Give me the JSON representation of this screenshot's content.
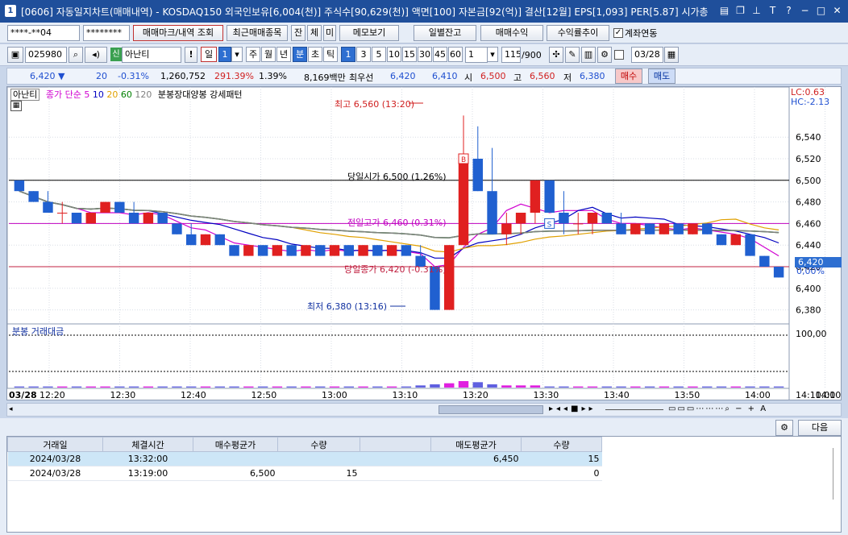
{
  "window": {
    "number": "1",
    "title": "[0606] 자동일지차트(매매내역) - KOSDAQ150 외국인보유[6,004(천)] 주식수[90,629(천)] 액면[100] 자본금[92(억)] 결산[12월] EPS[1,093] PER[5.87] 시가총"
  },
  "toolbar1": {
    "account": "****-**04",
    "password": "********",
    "btn_marks": "매매마크/내역 조회",
    "btn_recent": "최근매매종목",
    "btn_jan": "잔",
    "btn_che": "체",
    "btn_mi": "미",
    "btn_memo": "메모보기",
    "btn_daily": "일별잔고",
    "btn_profit": "매매수익",
    "btn_rate": "수익률추이",
    "chk_link": "계좌연동"
  },
  "toolbar2": {
    "code": "025980",
    "badge": "신",
    "name": "아난티",
    "excl": "!",
    "period_day": "일",
    "period_sel": "1",
    "p_week": "주",
    "p_month": "월",
    "p_year": "년",
    "p_min": "분",
    "p_sec": "초",
    "p_tick": "틱",
    "mins": [
      "1",
      "3",
      "5",
      "10",
      "15",
      "30",
      "45",
      "60"
    ],
    "count": "1",
    "bars": "115",
    "bars_max": "/900",
    "date": "03/28"
  },
  "strip": {
    "price": "6,420 ▼",
    "change": "20",
    "change_pct": "-0.31%",
    "volume": "1,260,752",
    "vol_ratio": "291.39%",
    "turnover": "1.39%",
    "amount": "8,169백만",
    "pref_label": "최우선",
    "ask": "6,420",
    "bid": "6,410",
    "open_label": "시",
    "open": "6,500",
    "high_label": "고",
    "high": "6,560",
    "low_label": "저",
    "low": "6,380",
    "buy": "매수",
    "sell": "매도"
  },
  "chart": {
    "stock_tag": "아난티",
    "legend_label": "종가 단순",
    "ma": [
      "5",
      "10",
      "20",
      "60",
      "120"
    ],
    "ma_colors": [
      "#d000d0",
      "#0000c0",
      "#e0a000",
      "#008000",
      "#808080"
    ],
    "pattern": "분봉장대양봉 강세패턴",
    "lc": "LC:0.63",
    "hc": "HC:-2.13",
    "ann_high": "최고 6,560 (13:20)",
    "ann_low": "최저 6,380 (13:16)",
    "ann_open": "당일시가 6,500 (1.26%)",
    "ann_prev": "전일고가 6,460 (0.31%)",
    "ann_close": "당일종가 6,420 (-0.31%)",
    "cur_price": "6,420",
    "cur_pct": "0,00%",
    "buy_mark": "B",
    "sell_mark": "S",
    "vol_title": "분봉 거래대금",
    "vol_tick": "100,00",
    "date_label": "03/28",
    "time_end": "14:10:00",
    "buy_color": "#e02020",
    "sell_color": "#2060d0"
  },
  "chart_data": {
    "type": "candlestick",
    "y_ticks": [
      "6,540",
      "6,520",
      "6,500",
      "6,480",
      "6,460",
      "6,440",
      "6,420",
      "6,400",
      "6,380"
    ],
    "ylim": [
      6370,
      6570
    ],
    "x_ticks": [
      "12:20",
      "12:30",
      "12:40",
      "12:50",
      "13:00",
      "13:10",
      "13:20",
      "13:30",
      "13:40",
      "13:50",
      "14:00",
      "14:10"
    ],
    "candles": [
      [
        6500,
        6500,
        6490,
        6490
      ],
      [
        6490,
        6490,
        6480,
        6480
      ],
      [
        6480,
        6490,
        6470,
        6470
      ],
      [
        6470,
        6480,
        6460,
        6470
      ],
      [
        6470,
        6470,
        6460,
        6460
      ],
      [
        6460,
        6470,
        6460,
        6470
      ],
      [
        6470,
        6480,
        6470,
        6480
      ],
      [
        6480,
        6480,
        6470,
        6470
      ],
      [
        6470,
        6480,
        6460,
        6460
      ],
      [
        6460,
        6470,
        6460,
        6470
      ],
      [
        6470,
        6470,
        6460,
        6460
      ],
      [
        6460,
        6460,
        6450,
        6450
      ],
      [
        6450,
        6460,
        6440,
        6440
      ],
      [
        6440,
        6450,
        6440,
        6450
      ],
      [
        6450,
        6450,
        6440,
        6440
      ],
      [
        6440,
        6440,
        6430,
        6430
      ],
      [
        6430,
        6440,
        6430,
        6440
      ],
      [
        6440,
        6440,
        6430,
        6430
      ],
      [
        6430,
        6440,
        6430,
        6440
      ],
      [
        6440,
        6440,
        6430,
        6430
      ],
      [
        6430,
        6440,
        6430,
        6440
      ],
      [
        6440,
        6440,
        6430,
        6430
      ],
      [
        6430,
        6440,
        6430,
        6440
      ],
      [
        6440,
        6440,
        6430,
        6430
      ],
      [
        6430,
        6440,
        6430,
        6440
      ],
      [
        6440,
        6440,
        6430,
        6430
      ],
      [
        6430,
        6440,
        6430,
        6440
      ],
      [
        6440,
        6440,
        6430,
        6430
      ],
      [
        6430,
        6440,
        6420,
        6420
      ],
      [
        6420,
        6410,
        6380,
        6380
      ],
      [
        6380,
        6440,
        6380,
        6440
      ],
      [
        6440,
        6560,
        6440,
        6520
      ],
      [
        6520,
        6550,
        6490,
        6490
      ],
      [
        6490,
        6530,
        6450,
        6450
      ],
      [
        6450,
        6470,
        6440,
        6460
      ],
      [
        6460,
        6470,
        6450,
        6470
      ],
      [
        6470,
        6500,
        6460,
        6500
      ],
      [
        6500,
        6500,
        6470,
        6470
      ],
      [
        6470,
        6490,
        6450,
        6460
      ],
      [
        6460,
        6470,
        6450,
        6460
      ],
      [
        6460,
        6470,
        6450,
        6470
      ],
      [
        6470,
        6470,
        6460,
        6460
      ],
      [
        6460,
        6470,
        6450,
        6450
      ],
      [
        6450,
        6460,
        6450,
        6460
      ],
      [
        6460,
        6460,
        6450,
        6450
      ],
      [
        6450,
        6460,
        6450,
        6460
      ],
      [
        6460,
        6460,
        6450,
        6450
      ],
      [
        6450,
        6460,
        6450,
        6460
      ],
      [
        6460,
        6460,
        6450,
        6450
      ],
      [
        6450,
        6450,
        6440,
        6440
      ],
      [
        6440,
        6450,
        6440,
        6450
      ],
      [
        6450,
        6450,
        6430,
        6430
      ],
      [
        6430,
        6430,
        6420,
        6420
      ],
      [
        6420,
        6420,
        6410,
        6410
      ]
    ],
    "volume_values": [
      1,
      1,
      1,
      1,
      1,
      1,
      1,
      1,
      1,
      1,
      1,
      1,
      1,
      1,
      1,
      1,
      1,
      1,
      1,
      1,
      1,
      1,
      1,
      1,
      1,
      1,
      1,
      1,
      2,
      3,
      4,
      6,
      5,
      3,
      2,
      2,
      2,
      1,
      1,
      1,
      1,
      1,
      1,
      1,
      1,
      1,
      1,
      1,
      1,
      1,
      1,
      1,
      1,
      1
    ],
    "ma5_color": "#d000d0",
    "ma10_color": "#0000c0",
    "ma20_color": "#e0a000",
    "ma60_color": "#008000",
    "ma120_color": "#808080",
    "levels": [
      6500,
      6460,
      6420
    ]
  },
  "scrollbar": {
    "label": "scroll"
  },
  "bottom": {
    "next": "다음",
    "headers": [
      "거래일",
      "체결시간",
      "매수평균가",
      "수량",
      "",
      "매도평균가",
      "수량"
    ],
    "rows": [
      [
        "2024/03/28",
        "13:32:00",
        "",
        "",
        "",
        "6,450",
        "15"
      ],
      [
        "2024/03/28",
        "13:19:00",
        "6,500",
        "15",
        "",
        "",
        "0"
      ]
    ]
  }
}
